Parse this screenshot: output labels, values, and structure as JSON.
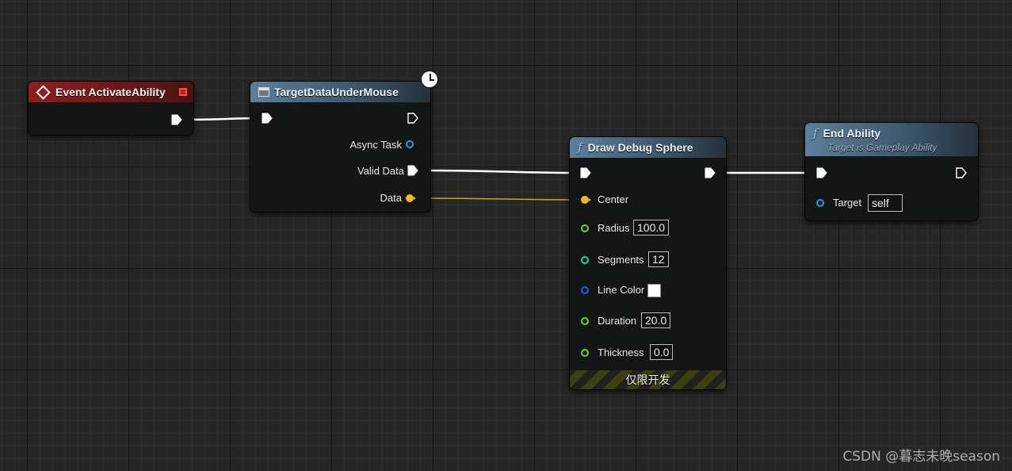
{
  "colors": {
    "exec": "#ffffff",
    "struct": "#f4b71c",
    "object": "#1c9fe8",
    "float": "#6fd51c",
    "int": "#1fd3a6",
    "linear_color": "#1c5fe8",
    "event_header": "#8e1f1f",
    "function_header": "#5c7f9c"
  },
  "nodes": {
    "event_activate": {
      "title": "Event ActivateAbility",
      "icon": "event-diamond-icon"
    },
    "target_data": {
      "title": "TargetDataUnderMouse",
      "icon": "macro-node-icon",
      "badge": "latent-clock-icon",
      "pins": {
        "async_task": "Async Task",
        "valid_data": "Valid Data",
        "data": "Data"
      }
    },
    "draw_debug_sphere": {
      "title": "Draw Debug Sphere",
      "icon": "function-icon",
      "pins": {
        "center": "Center",
        "radius": "Radius",
        "segments": "Segments",
        "line_color": "Line Color",
        "duration": "Duration",
        "thickness": "Thickness"
      },
      "values": {
        "radius": "100.0",
        "segments": "12",
        "line_color": "#ffffff",
        "duration": "20.0",
        "thickness": "0.0"
      },
      "footer": "仅限开发"
    },
    "end_ability": {
      "title": "End Ability",
      "subtitle": "Target is Gameplay Ability",
      "icon": "function-icon",
      "pins": {
        "target": "Target"
      },
      "values": {
        "target": "self"
      }
    }
  },
  "watermark": "CSDN @暮志未晚season"
}
